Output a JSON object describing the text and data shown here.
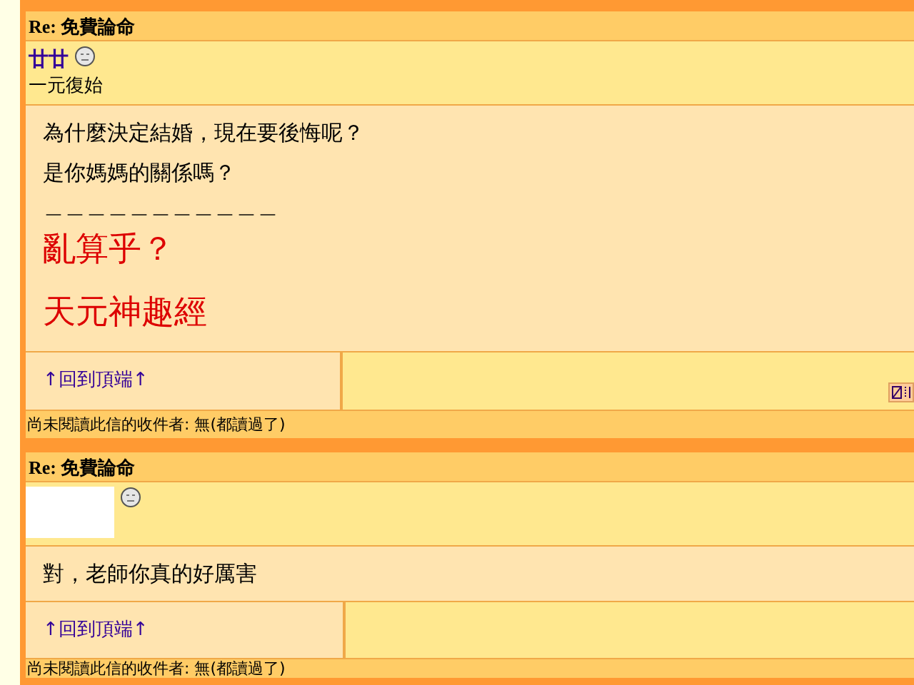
{
  "posts": [
    {
      "title": "Re: 免費論命",
      "author": "廿廿",
      "signature": "一元復始",
      "has_avatar": false,
      "body": [
        {
          "kind": "text",
          "text": "為什麼決定結婚，現在要後悔呢？"
        },
        {
          "kind": "text",
          "text": "是你媽媽的關係嗎？"
        },
        {
          "kind": "rule",
          "text": "＿＿＿＿＿＿＿＿＿＿＿"
        },
        {
          "kind": "big",
          "text": "亂算乎？"
        },
        {
          "kind": "big",
          "text": "天元神趣經"
        }
      ],
      "back_link": "↑回到頂端↑",
      "footer_icon": true,
      "unread_status": "尚未閱讀此信的收件者: 無(都讀過了)"
    },
    {
      "title": "Re: 免費論命",
      "has_avatar": true,
      "body": [
        {
          "kind": "text",
          "text": "對，老師你真的好厲害"
        }
      ],
      "back_link": "↑回到頂端↑",
      "footer_icon": false,
      "unread_status": "尚未閱讀此信的收件者: 無(都讀過了)"
    }
  ]
}
